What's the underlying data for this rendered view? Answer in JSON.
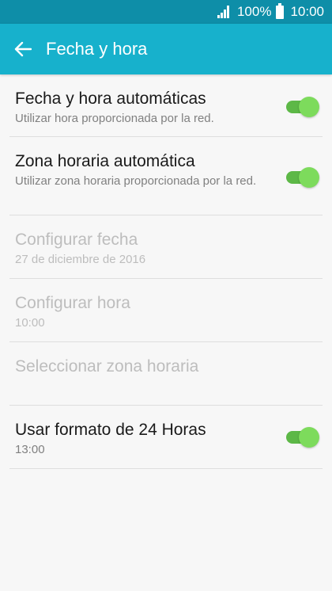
{
  "status_bar": {
    "battery_percent": "100%",
    "time": "10:00"
  },
  "app_bar": {
    "title": "Fecha y hora",
    "back_icon": "arrow-left-icon"
  },
  "settings": [
    {
      "title": "Fecha y hora automáticas",
      "summary": "Utilizar hora proporcionada por la red.",
      "toggle": true,
      "on": true,
      "enabled": true
    },
    {
      "title": "Zona horaria automática",
      "summary": "Utilizar zona horaria proporcionada por la red.",
      "toggle": true,
      "on": true,
      "enabled": true
    },
    {
      "title": "Configurar fecha",
      "summary": "27 de diciembre de 2016",
      "toggle": false,
      "enabled": false
    },
    {
      "title": "Configurar hora",
      "summary": "10:00",
      "toggle": false,
      "enabled": false
    },
    {
      "title": "Seleccionar zona horaria",
      "summary": "",
      "toggle": false,
      "enabled": false
    },
    {
      "title": "Usar formato de 24 Horas",
      "summary": "13:00",
      "toggle": true,
      "on": true,
      "enabled": true
    }
  ],
  "colors": {
    "status_bar": "#0e8ea8",
    "app_bar": "#17b1cc",
    "toggle_track": "#5db847",
    "toggle_knob": "#7ddb5c"
  }
}
